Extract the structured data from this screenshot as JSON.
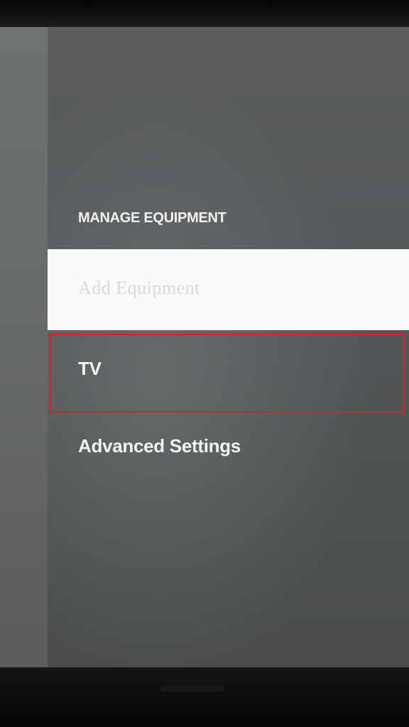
{
  "settings": {
    "section_title": "MANAGE EQUIPMENT",
    "items": [
      {
        "label": "Add Equipment",
        "selected": true
      },
      {
        "label": "TV",
        "selected": false
      },
      {
        "label": "Advanced Settings",
        "selected": false
      }
    ]
  },
  "colors": {
    "highlight_outline": "#d4232c",
    "selected_background": "#fafafa",
    "panel_background": "#55585a"
  }
}
